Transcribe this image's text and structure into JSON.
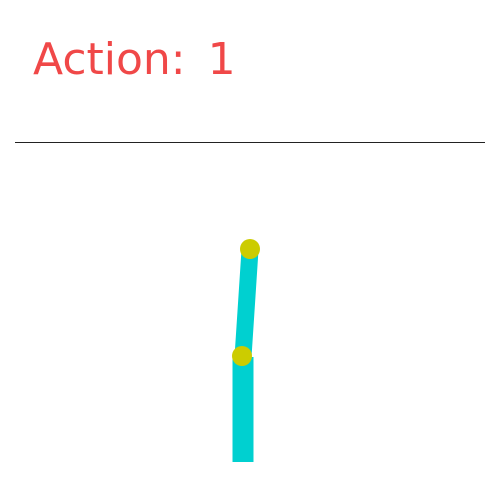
{
  "hud": {
    "action_caption": "Action:",
    "action_value": "1"
  },
  "colors": {
    "text": "#f04848",
    "link": "#00d0d0",
    "joint": "#cccc00",
    "line": "#222222",
    "background": "#ffffff"
  },
  "scene": {
    "links": [
      {
        "name": "lower-link"
      },
      {
        "name": "upper-link"
      }
    ],
    "joints": [
      {
        "name": "middle-joint"
      },
      {
        "name": "top-joint"
      }
    ]
  }
}
